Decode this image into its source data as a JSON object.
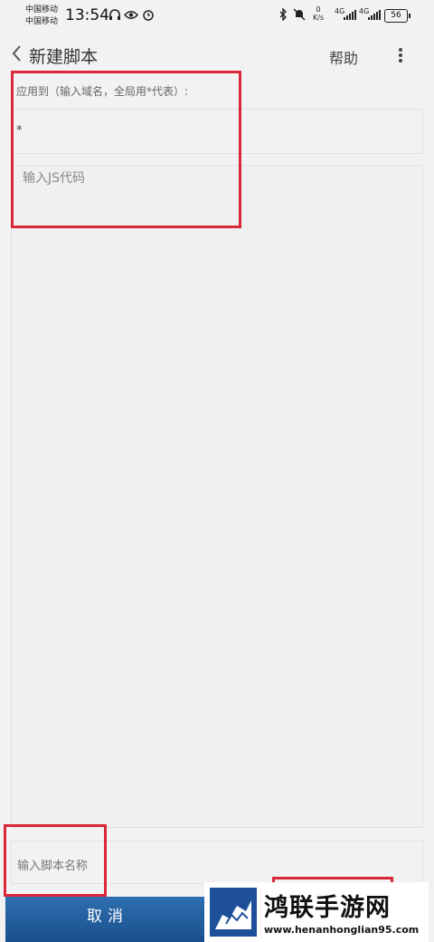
{
  "status_bar": {
    "carrier_1": "中国移动",
    "carrier_2": "中国移动",
    "time": "13:54",
    "net_speed_value": "0",
    "net_speed_unit": "K/s",
    "signal_1_label": "4G",
    "signal_2_label": "4G",
    "battery": "56"
  },
  "app_bar": {
    "title": "新建脚本",
    "help_label": "帮助"
  },
  "form": {
    "apply_to_label": "应用到（输入域名，全局用*代表）:",
    "domain_value": "*",
    "code_placeholder": "输入JS代码",
    "name_placeholder": "输入脚本名称"
  },
  "buttons": {
    "cancel_label": "取消"
  },
  "watermark": {
    "title": "鸿联手游网",
    "url": "www.henanhonglian95.com"
  },
  "colors": {
    "primary_button": "#1a4f8d",
    "annotation": "#d9283a",
    "background": "#f2f2f2"
  }
}
